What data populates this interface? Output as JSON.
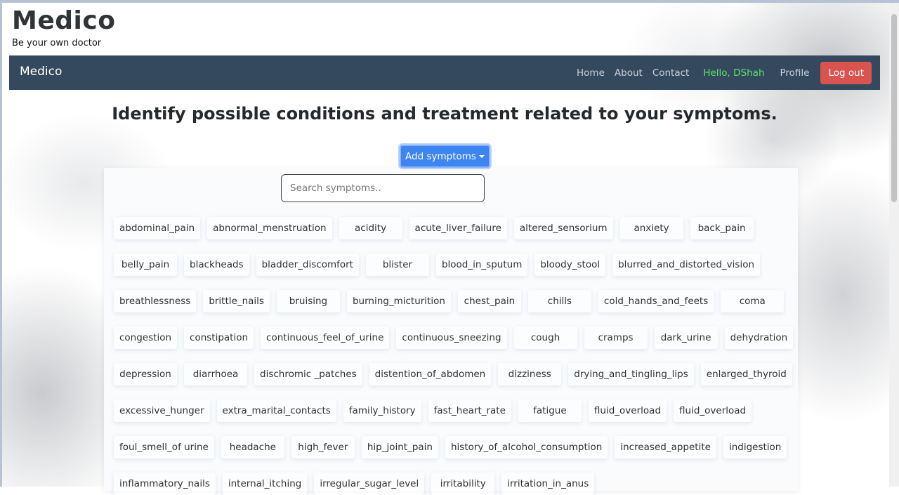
{
  "brand": {
    "title": "Medico",
    "tagline": "Be your own doctor"
  },
  "navbar": {
    "brand": "Medico",
    "links": [
      "Home",
      "About",
      "Contact"
    ],
    "greeting": "Hello, DShah",
    "profile": "Profile",
    "logout": "Log out"
  },
  "main": {
    "heading": "Identify possible conditions and treatment related to your symptoms.",
    "add_button": "Add symptoms"
  },
  "search": {
    "placeholder": "Search symptoms.."
  },
  "symptoms": [
    "abdominal_pain",
    "abnormal_menstruation",
    "acidity",
    "acute_liver_failure",
    "altered_sensorium",
    "anxiety",
    "back_pain",
    "belly_pain",
    "blackheads",
    "bladder_discomfort",
    "blister",
    "blood_in_sputum",
    "bloody_stool",
    "blurred_and_distorted_vision",
    "breathlessness",
    "brittle_nails",
    "bruising",
    "burning_micturition",
    "chest_pain",
    "chills",
    "cold_hands_and_feets",
    "coma",
    "congestion",
    "constipation",
    "continuous_feel_of_urine",
    "continuous_sneezing",
    "cough",
    "cramps",
    "dark_urine",
    "dehydration",
    "depression",
    "diarrhoea",
    "dischromic _patches",
    "distention_of_abdomen",
    "dizziness",
    "drying_and_tingling_lips",
    "enlarged_thyroid",
    "excessive_hunger",
    "extra_marital_contacts",
    "family_history",
    "fast_heart_rate",
    "fatigue",
    "fluid_overload",
    "fluid_overload",
    "foul_smell_of urine",
    "headache",
    "high_fever",
    "hip_joint_pain",
    "history_of_alcohol_consumption",
    "increased_appetite",
    "indigestion",
    "inflammatory_nails",
    "internal_itching",
    "irregular_sugar_level",
    "irritability",
    "irritation_in_anus"
  ],
  "colors": {
    "navbar": "#34495e",
    "greeting": "#5ee26a",
    "logout": "#d9534f",
    "primary": "#3d85f0"
  }
}
